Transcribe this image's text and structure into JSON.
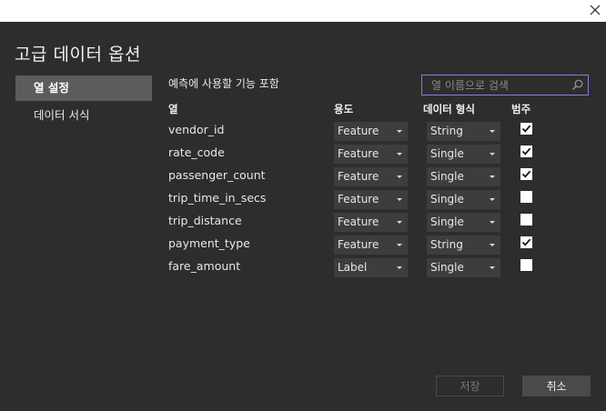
{
  "dialog": {
    "title": "고급 데이터 옵션"
  },
  "nav": {
    "items": [
      {
        "label": "열 설정",
        "active": true
      },
      {
        "label": "데이터 서식",
        "active": false
      }
    ]
  },
  "main": {
    "section_label": "예측에 사용할 기능 포함",
    "search_placeholder": "열 이름으로 검색",
    "headers": {
      "column": "열",
      "usage": "용도",
      "format": "데이터 형식",
      "category": "범주"
    },
    "rows": [
      {
        "name": "vendor_id",
        "usage": "Feature",
        "format": "String",
        "category": true
      },
      {
        "name": "rate_code",
        "usage": "Feature",
        "format": "Single",
        "category": true
      },
      {
        "name": "passenger_count",
        "usage": "Feature",
        "format": "Single",
        "category": true
      },
      {
        "name": "trip_time_in_secs",
        "usage": "Feature",
        "format": "Single",
        "category": false
      },
      {
        "name": "trip_distance",
        "usage": "Feature",
        "format": "Single",
        "category": false
      },
      {
        "name": "payment_type",
        "usage": "Feature",
        "format": "String",
        "category": true
      },
      {
        "name": "fare_amount",
        "usage": "Label",
        "format": "Single",
        "category": false
      }
    ]
  },
  "footer": {
    "save_label": "저장",
    "cancel_label": "취소"
  },
  "colors": {
    "background": "#2d2d2d",
    "active_nav": "#5c5c5c",
    "search_border": "#8a7de0",
    "dropdown_bg": "#3d3d3d"
  },
  "icons": {
    "close": "close-icon",
    "search": "search-icon",
    "caret": "chevron-down-icon",
    "check": "check-icon"
  }
}
